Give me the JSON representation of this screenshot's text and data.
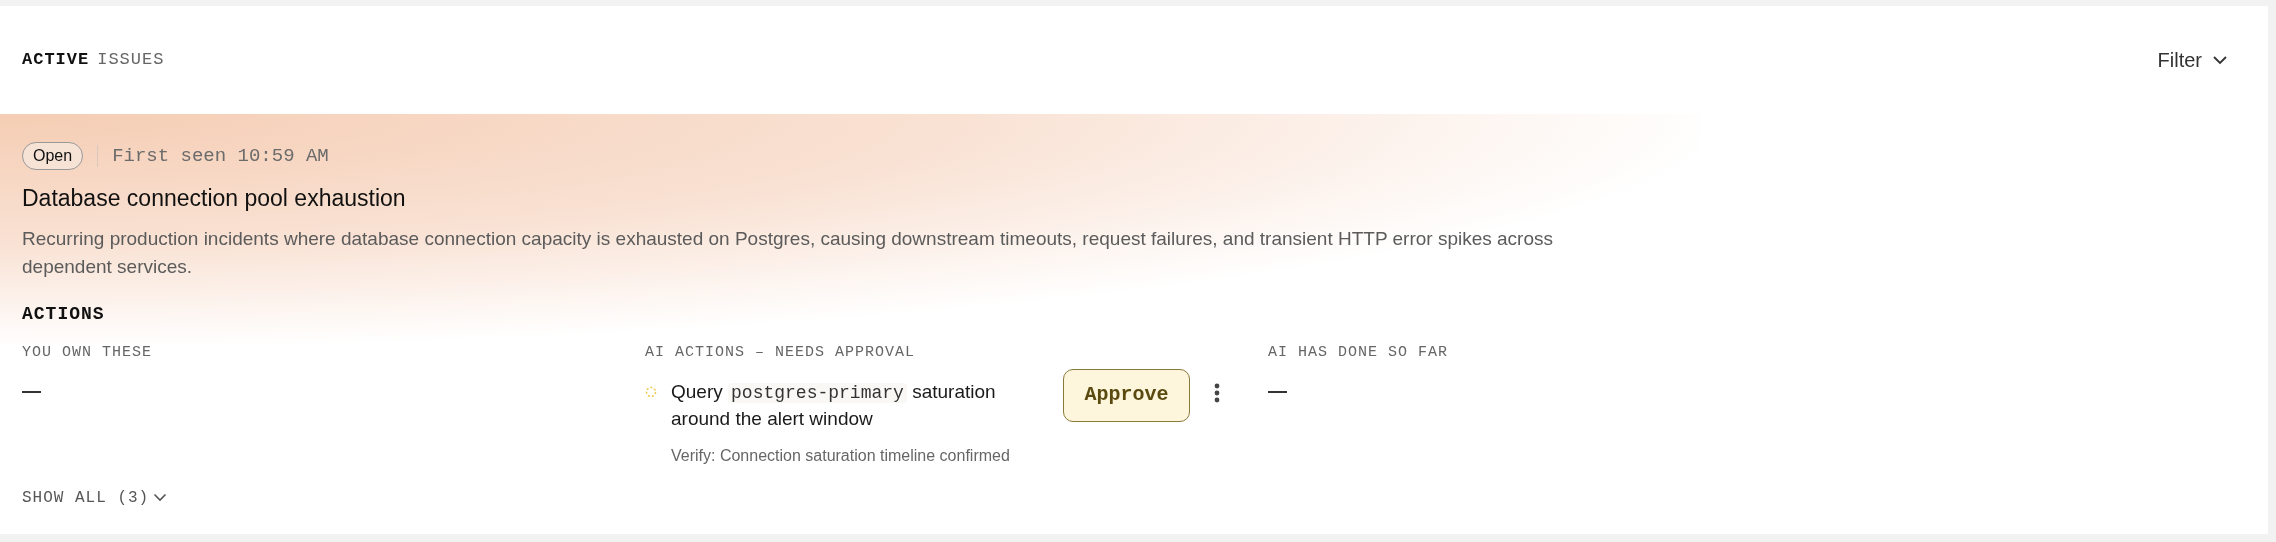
{
  "header": {
    "title_strong": "ACTIVE",
    "title_light": "ISSUES",
    "filter": "Filter"
  },
  "issue": {
    "status": "Open",
    "first_seen": "First seen 10:59 AM",
    "title": "Database connection pool exhaustion",
    "description": "Recurring production incidents where database connection capacity is exhausted on Postgres, causing downstream timeouts, request failures, and transient HTTP error spikes across dependent services.",
    "actions_heading": "ACTIONS",
    "columns": [
      {
        "kind": "empty",
        "heading": "YOU OWN THESE"
      },
      {
        "kind": "approval",
        "heading": "AI ACTIONS – NEEDS APPROVAL",
        "items": [
          {
            "segments": [
              {
                "kind": "text",
                "text": "Query "
              },
              {
                "kind": "code",
                "text": "postgres-primary"
              },
              {
                "kind": "text",
                "text": " saturation around the alert window"
              }
            ],
            "verify": "Verify: Connection saturation timeline confirmed",
            "button": "Approve"
          }
        ]
      },
      {
        "kind": "empty",
        "heading": "AI HAS DONE SO FAR"
      }
    ],
    "show_all": "SHOW ALL (3)"
  }
}
